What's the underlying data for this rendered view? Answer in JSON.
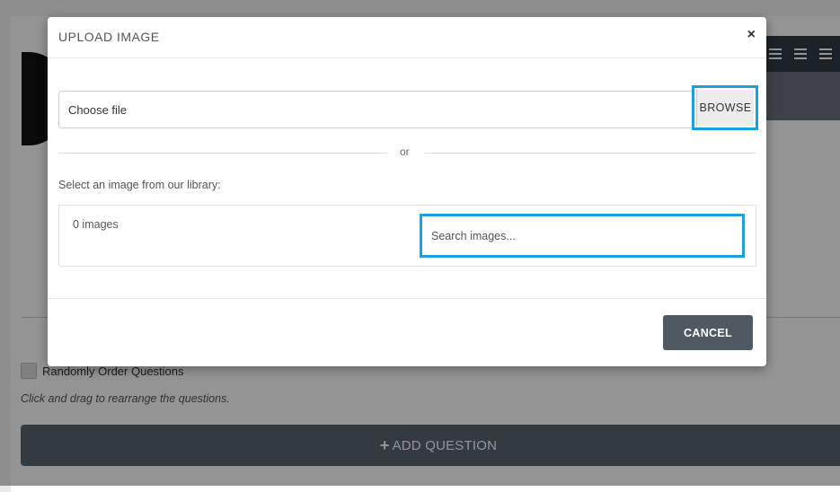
{
  "background": {
    "randomize_label": "Randomly Order Questions",
    "hint": "Click and drag to rearrange the questions.",
    "add_question_icon": "plus-icon",
    "add_question_label": "ADD QUESTION"
  },
  "modal": {
    "title": "UPLOAD IMAGE",
    "close_icon": "close-icon",
    "close_glyph": "×",
    "file_input": {
      "placeholder": "Choose file",
      "browse_label": "BROWSE"
    },
    "divider_text": "or",
    "library_label": "Select an image from our library:",
    "library": {
      "count_text": "0 images",
      "search_placeholder": "Search images..."
    },
    "footer": {
      "cancel_label": "CANCEL"
    }
  },
  "colors": {
    "highlight": "#1aa1e1",
    "cancel_button": "#4e5962",
    "add_question_button": "#59646e"
  }
}
